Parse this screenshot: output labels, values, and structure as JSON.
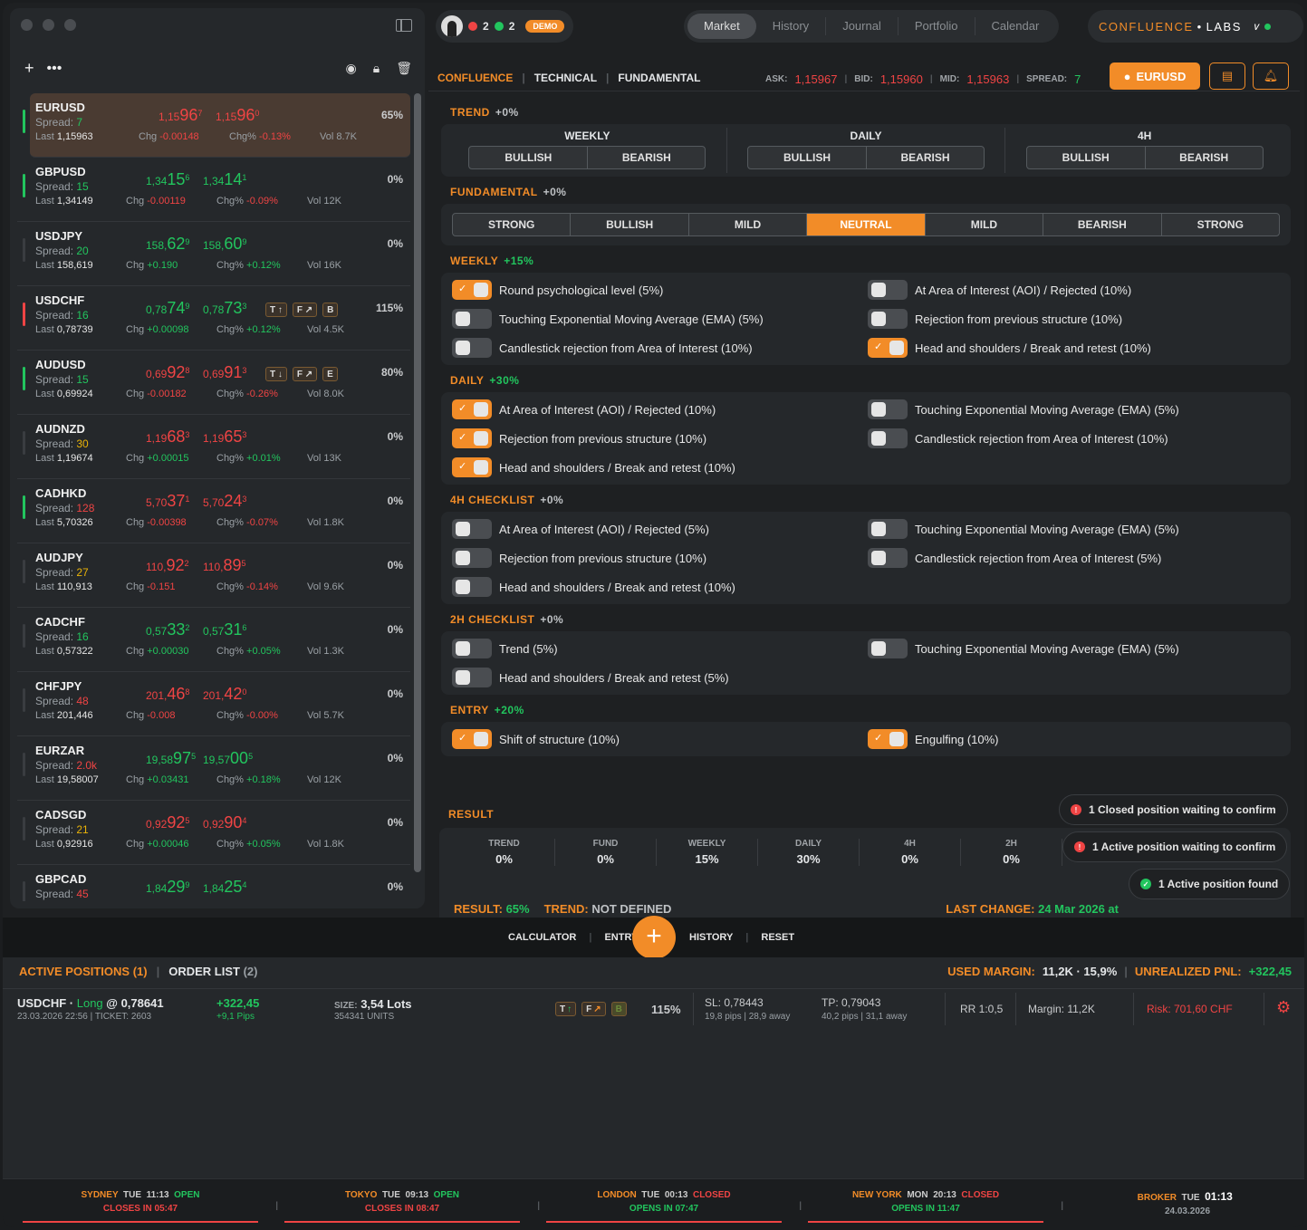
{
  "window": {
    "brand_a": "CONFLUENCE",
    "brand_b": "LABS",
    "user": {
      "red_count": "2",
      "green_count": "2",
      "badge": "DEMO"
    }
  },
  "nav": [
    "Market",
    "History",
    "Journal",
    "Portfolio",
    "Calendar"
  ],
  "watchlist": [
    {
      "sym": "EURUSD",
      "spread": "7",
      "spread_color": "#22c55e",
      "last": "1,15963",
      "bid_a": "1,15",
      "bid_b": "96",
      "bid_c": "7",
      "ask_a": "1,15",
      "ask_b": "96",
      "ask_c": "0",
      "price_color": "#ef4444",
      "chg": "-0.00148",
      "chgp": "-0.13%",
      "chg_color": "#ef4444",
      "vol": "Vol 8.7K",
      "pct": "65%",
      "bar": "#22c55e",
      "badges": []
    },
    {
      "sym": "GBPUSD",
      "spread": "15",
      "spread_color": "#22c55e",
      "last": "1,34149",
      "bid_a": "1,34",
      "bid_b": "15",
      "bid_c": "6",
      "ask_a": "1,34",
      "ask_b": "14",
      "ask_c": "1",
      "price_color": "#22c55e",
      "chg": "-0.00119",
      "chgp": "-0.09%",
      "chg_color": "#ef4444",
      "vol": "Vol 12K",
      "pct": "0%",
      "bar": "#22c55e",
      "badges": []
    },
    {
      "sym": "USDJPY",
      "spread": "20",
      "spread_color": "#22c55e",
      "last": "158,619",
      "bid_a": "158,",
      "bid_b": "62",
      "bid_c": "9",
      "ask_a": "158,",
      "ask_b": "60",
      "ask_c": "9",
      "price_color": "#22c55e",
      "chg": "+0.190",
      "chgp": "+0.12%",
      "chg_color": "#22c55e",
      "vol": "Vol 16K",
      "pct": "0%",
      "bar": "#3a3d41",
      "badges": []
    },
    {
      "sym": "USDCHF",
      "spread": "16",
      "spread_color": "#22c55e",
      "last": "0,78739",
      "bid_a": "0,78",
      "bid_b": "74",
      "bid_c": "9",
      "ask_a": "0,78",
      "ask_b": "73",
      "ask_c": "3",
      "price_color": "#22c55e",
      "chg": "+0.00098",
      "chgp": "+0.12%",
      "chg_color": "#22c55e",
      "vol": "Vol 4.5K",
      "pct": "115%",
      "bar": "#ef4444",
      "badges": [
        "T ↑",
        "F ↗",
        "B"
      ]
    },
    {
      "sym": "AUDUSD",
      "spread": "15",
      "spread_color": "#22c55e",
      "last": "0,69924",
      "bid_a": "0,69",
      "bid_b": "92",
      "bid_c": "8",
      "ask_a": "0,69",
      "ask_b": "91",
      "ask_c": "3",
      "price_color": "#ef4444",
      "chg": "-0.00182",
      "chgp": "-0.26%",
      "chg_color": "#ef4444",
      "vol": "Vol 8.0K",
      "pct": "80%",
      "bar": "#22c55e",
      "badges": [
        "T ↓",
        "F ↗",
        "E"
      ]
    },
    {
      "sym": "AUDNZD",
      "spread": "30",
      "spread_color": "#eab308",
      "last": "1,19674",
      "bid_a": "1,19",
      "bid_b": "68",
      "bid_c": "3",
      "ask_a": "1,19",
      "ask_b": "65",
      "ask_c": "3",
      "price_color": "#ef4444",
      "chg": "+0.00015",
      "chgp": "+0.01%",
      "chg_color": "#22c55e",
      "vol": "Vol 13K",
      "pct": "0%",
      "bar": "#3a3d41",
      "badges": []
    },
    {
      "sym": "CADHKD",
      "spread": "128",
      "spread_color": "#ef4444",
      "last": "5,70326",
      "bid_a": "5,70",
      "bid_b": "37",
      "bid_c": "1",
      "ask_a": "5,70",
      "ask_b": "24",
      "ask_c": "3",
      "price_color": "#ef4444",
      "chg": "-0.00398",
      "chgp": "-0.07%",
      "chg_color": "#ef4444",
      "vol": "Vol 1.8K",
      "pct": "0%",
      "bar": "#22c55e",
      "badges": []
    },
    {
      "sym": "AUDJPY",
      "spread": "27",
      "spread_color": "#eab308",
      "last": "110,913",
      "bid_a": "110,",
      "bid_b": "92",
      "bid_c": "2",
      "ask_a": "110,",
      "ask_b": "89",
      "ask_c": "5",
      "price_color": "#ef4444",
      "chg": "-0.151",
      "chgp": "-0.14%",
      "chg_color": "#ef4444",
      "vol": "Vol 9.6K",
      "pct": "0%",
      "bar": "#3a3d41",
      "badges": []
    },
    {
      "sym": "CADCHF",
      "spread": "16",
      "spread_color": "#22c55e",
      "last": "0,57322",
      "bid_a": "0,57",
      "bid_b": "33",
      "bid_c": "2",
      "ask_a": "0,57",
      "ask_b": "31",
      "ask_c": "6",
      "price_color": "#22c55e",
      "chg": "+0.00030",
      "chgp": "+0.05%",
      "chg_color": "#22c55e",
      "vol": "Vol 1.3K",
      "pct": "0%",
      "bar": "#3a3d41",
      "badges": []
    },
    {
      "sym": "CHFJPY",
      "spread": "48",
      "spread_color": "#ef4444",
      "last": "201,446",
      "bid_a": "201,",
      "bid_b": "46",
      "bid_c": "8",
      "ask_a": "201,",
      "ask_b": "42",
      "ask_c": "0",
      "price_color": "#ef4444",
      "chg": "-0.008",
      "chgp": "-0.00%",
      "chg_color": "#ef4444",
      "vol": "Vol 5.7K",
      "pct": "0%",
      "bar": "#3a3d41",
      "badges": []
    },
    {
      "sym": "EURZAR",
      "spread": "2.0k",
      "spread_color": "#ef4444",
      "last": "19,58007",
      "bid_a": "19,58",
      "bid_b": "97",
      "bid_c": "5",
      "ask_a": "19,57",
      "ask_b": "00",
      "ask_c": "5",
      "price_color": "#22c55e",
      "chg": "+0.03431",
      "chgp": "+0.18%",
      "chg_color": "#22c55e",
      "vol": "Vol 12K",
      "pct": "0%",
      "bar": "#3a3d41",
      "badges": []
    },
    {
      "sym": "CADSGD",
      "spread": "21",
      "spread_color": "#eab308",
      "last": "0,92916",
      "bid_a": "0,92",
      "bid_b": "92",
      "bid_c": "5",
      "ask_a": "0,92",
      "ask_b": "90",
      "ask_c": "4",
      "price_color": "#ef4444",
      "chg": "+0.00046",
      "chgp": "+0.05%",
      "chg_color": "#22c55e",
      "vol": "Vol 1.8K",
      "pct": "0%",
      "bar": "#3a3d41",
      "badges": []
    },
    {
      "sym": "GBPCAD",
      "spread": "45",
      "spread_color": "#ef4444",
      "last": "",
      "bid_a": "1,84",
      "bid_b": "29",
      "bid_c": "9",
      "ask_a": "1,84",
      "ask_b": "25",
      "ask_c": "4",
      "price_color": "#22c55e",
      "chg": "",
      "chgp": "",
      "chg_color": "#22c55e",
      "vol": "",
      "pct": "0%",
      "bar": "#3a3d41",
      "badges": []
    }
  ],
  "labels": {
    "spread": "Spread: ",
    "last": "Last ",
    "chg": "Chg ",
    "chgp": "Chg% "
  },
  "subtabs": {
    "confluence": "CONFLUENCE",
    "technical": "TECHNICAL",
    "fundamental": "FUNDAMENTAL"
  },
  "quotes": {
    "ask_l": "ASK:",
    "ask": "1,15967",
    "bid_l": "BID:",
    "bid": "1,15960",
    "mid_l": "MID:",
    "mid": "1,15963",
    "spread_l": "SPREAD:",
    "spread": "7",
    "symbol": "EURUSD"
  },
  "trend": {
    "title": "TREND",
    "pct": "+0%",
    "cols": [
      "WEEKLY",
      "DAILY",
      "4H"
    ],
    "bull": "BULLISH",
    "bear": "BEARISH"
  },
  "fundamental": {
    "title": "FUNDAMENTAL",
    "pct": "+0%",
    "options": [
      "STRONG",
      "BULLISH",
      "MILD",
      "NEUTRAL",
      "MILD",
      "BEARISH",
      "STRONG"
    ],
    "selected": 3
  },
  "sections": [
    {
      "title": "WEEKLY",
      "pct": "+15%",
      "pct_green": true,
      "items": [
        {
          "label": "Round psychological level (5%)",
          "on": true
        },
        {
          "label": "At Area of Interest (AOI) / Rejected (10%)",
          "on": false
        },
        {
          "label": "Touching Exponential Moving Average (EMA) (5%)",
          "on": false
        },
        {
          "label": "Rejection from previous structure (10%)",
          "on": false
        },
        {
          "label": "Candlestick rejection from Area of Interest (10%)",
          "on": false
        },
        {
          "label": "Head and shoulders / Break and retest (10%)",
          "on": true
        }
      ]
    },
    {
      "title": "DAILY",
      "pct": "+30%",
      "pct_green": true,
      "items": [
        {
          "label": "At Area of Interest (AOI) / Rejected (10%)",
          "on": true
        },
        {
          "label": "Touching Exponential Moving Average (EMA) (5%)",
          "on": false
        },
        {
          "label": "Rejection from previous structure (10%)",
          "on": true
        },
        {
          "label": "Candlestick rejection from Area of Interest (10%)",
          "on": false
        },
        {
          "label": "Head and shoulders / Break and retest (10%)",
          "on": true
        }
      ]
    },
    {
      "title": "4H CHECKLIST",
      "pct": "+0%",
      "pct_green": false,
      "items": [
        {
          "label": "At Area of Interest (AOI) / Rejected (5%)",
          "on": false
        },
        {
          "label": "Touching Exponential Moving Average (EMA) (5%)",
          "on": false
        },
        {
          "label": "Rejection from previous structure (10%)",
          "on": false
        },
        {
          "label": "Candlestick rejection from Area of Interest (5%)",
          "on": false
        },
        {
          "label": "Head and shoulders / Break and retest (10%)",
          "on": false
        }
      ]
    },
    {
      "title": "2H CHECKLIST",
      "pct": "+0%",
      "pct_green": false,
      "items": [
        {
          "label": "Trend (5%)",
          "on": false
        },
        {
          "label": "Touching Exponential Moving Average (EMA) (5%)",
          "on": false
        },
        {
          "label": "Head and shoulders / Break and retest (5%)",
          "on": false
        }
      ]
    },
    {
      "title": "ENTRY",
      "pct": "+20%",
      "pct_green": true,
      "items": [
        {
          "label": "Shift of structure (10%)",
          "on": true
        },
        {
          "label": "Engulfing (10%)",
          "on": true
        }
      ]
    }
  ],
  "result": {
    "title": "RESULT",
    "cols": [
      {
        "h": "TREND",
        "v": "0%"
      },
      {
        "h": "FUND",
        "v": "0%"
      },
      {
        "h": "WEEKLY",
        "v": "15%"
      },
      {
        "h": "DAILY",
        "v": "30%"
      },
      {
        "h": "4H",
        "v": "0%"
      },
      {
        "h": "2H",
        "v": "0%"
      }
    ],
    "result_l": "RESULT:",
    "result_v": "65%",
    "trend_l": "TREND:",
    "trend_v": "NOT DEFINED",
    "change_l": "LAST CHANGE:",
    "change_v": "24 Mar 2026 at"
  },
  "toasts": [
    "1 Closed position waiting to confirm",
    "1 Active position waiting to confirm",
    "1 Active position found"
  ],
  "toolbar": {
    "calculator": "CALCULATOR",
    "entry": "ENTRY",
    "plus": "+",
    "history": "HISTORY",
    "reset": "RESET"
  },
  "positions": {
    "active": "ACTIVE POSITIONS",
    "active_n": "(1)",
    "orders": "ORDER LIST",
    "orders_n": "(2)",
    "margin_l": "USED MARGIN:",
    "margin_v": "11,2K · 15,9%",
    "pnl_l": "UNREALIZED PNL:",
    "pnl_v": "+322,45",
    "row": {
      "sym": "USDCHF",
      "side": "Long",
      "entry": "@ 0,78641",
      "meta": "23.03.2026 22:56 | TICKET: 2603",
      "pnl": "+322,45",
      "pips": "+9,1 Pips",
      "size_l": "SIZE:",
      "size": "3,54 Lots",
      "units": "354341 UNITS",
      "pct": "115%",
      "sl": "SL: 0,78443",
      "sl_sub": "19,8 pips | 28,9 away",
      "tp": "TP: 0,79043",
      "tp_sub": "40,2 pips | 31,1 away",
      "rr": "RR 1:0,5",
      "margin": "Margin: 11,2K",
      "risk": "Risk: 701,60 CHF"
    }
  },
  "sessions": [
    {
      "name": "SYDNEY",
      "day": "TUE",
      "time": "11:13",
      "status": "OPEN",
      "sub": "CLOSES IN 05:47"
    },
    {
      "name": "TOKYO",
      "day": "TUE",
      "time": "09:13",
      "status": "OPEN",
      "sub": "CLOSES IN 08:47"
    },
    {
      "name": "LONDON",
      "day": "TUE",
      "time": "00:13",
      "status": "CLOSED",
      "sub": "OPENS IN 07:47"
    },
    {
      "name": "NEW YORK",
      "day": "MON",
      "time": "20:13",
      "status": "CLOSED",
      "sub": "OPENS IN 11:47"
    },
    {
      "name": "BROKER",
      "day": "TUE",
      "time": "01:13",
      "status": "",
      "sub": "24.03.2026"
    }
  ]
}
